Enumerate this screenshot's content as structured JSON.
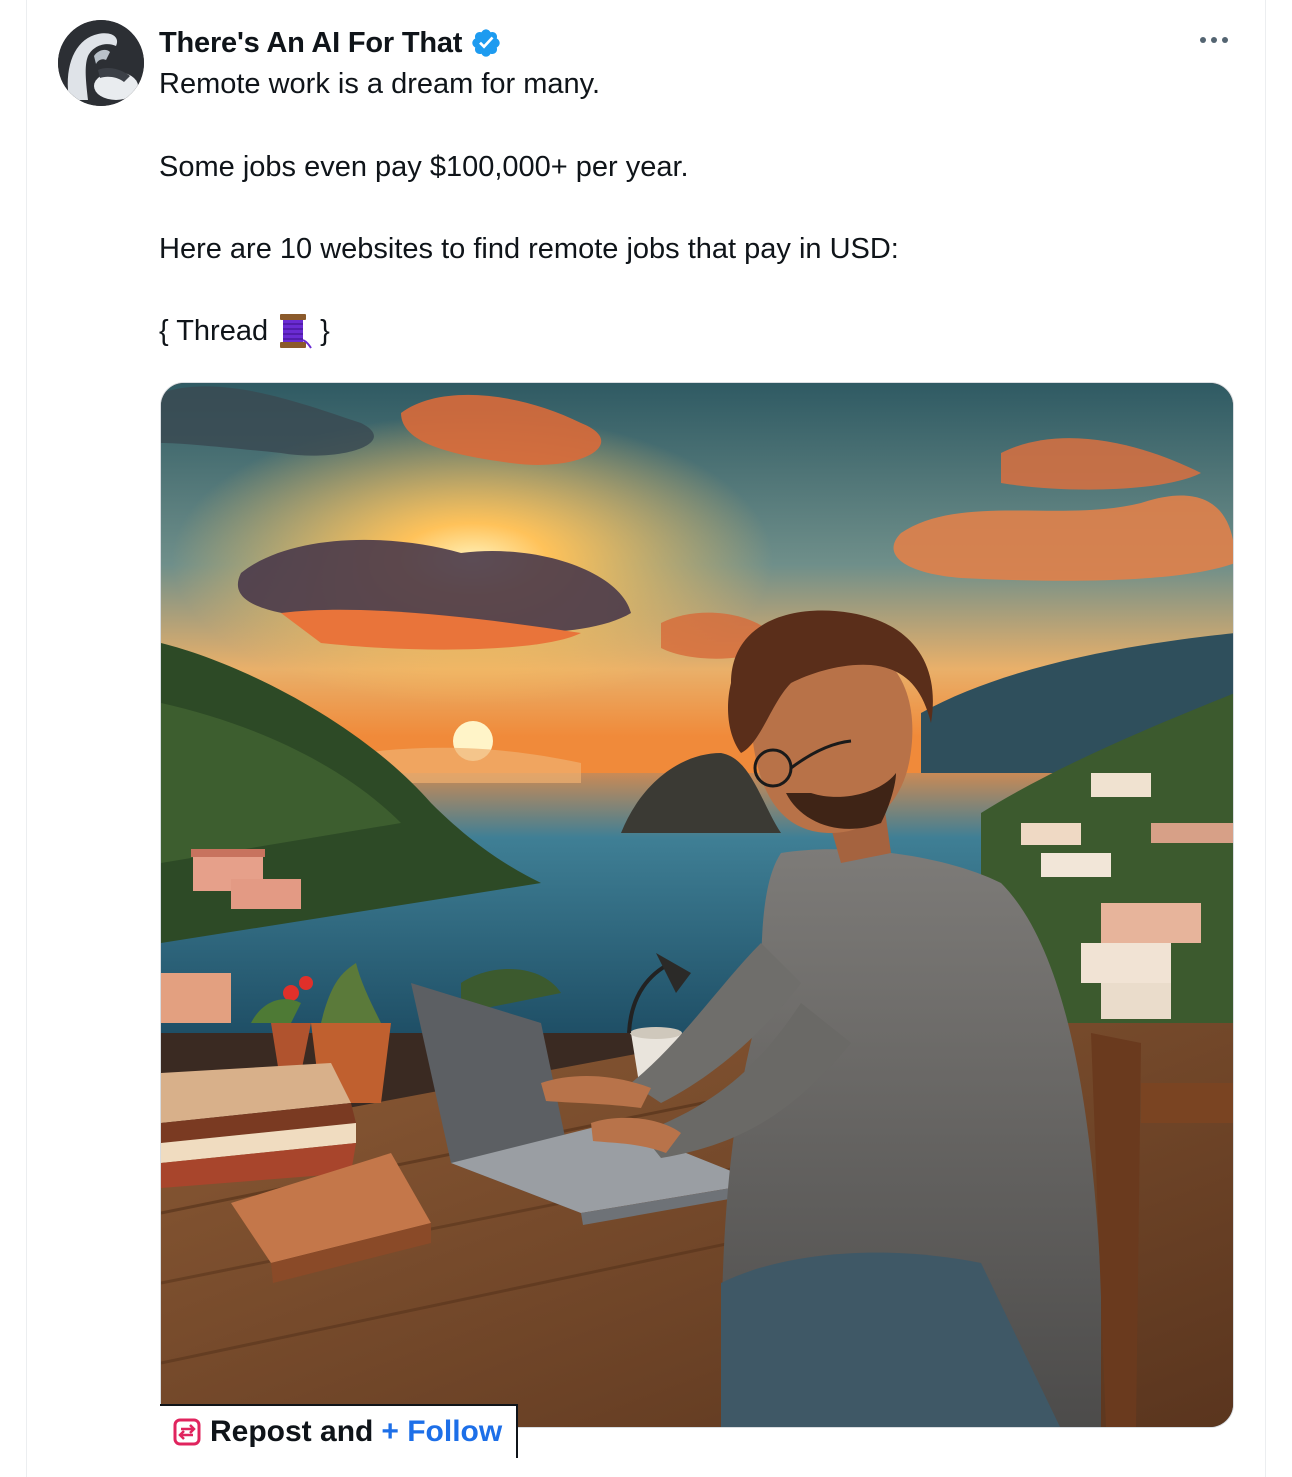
{
  "post": {
    "author_name": "There's An AI For That",
    "verified": true,
    "lines": {
      "l1": "Remote work is a dream for many.",
      "l2": "Some jobs even pay $100,000+ per year.",
      "l3": "Here are 10 websites to find remote jobs that pay in USD:",
      "thread_open": "{ Thread",
      "thread_close": "}"
    },
    "icons": {
      "avatar": "profile-avatar",
      "verified": "verified-badge-icon",
      "more": "more-options-icon",
      "thread": "thread-spool-icon",
      "repost": "repost-icon"
    },
    "media_alt": "photo",
    "overlay": {
      "repost_label": "Repost and",
      "follow_label": "+ Follow"
    }
  },
  "colors": {
    "text": "#0f1419",
    "verified_blue": "#1d9bf0",
    "follow_blue": "#1d6fe8",
    "repost_red": "#e0245e"
  }
}
